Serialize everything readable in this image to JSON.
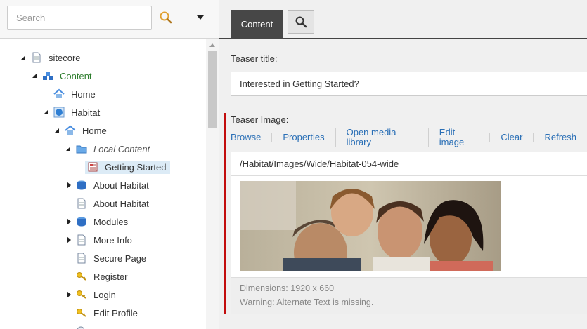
{
  "search": {
    "placeholder": "Search"
  },
  "tree": [
    {
      "label": "sitecore",
      "toggle": "expanded",
      "icon": "page-icon"
    },
    {
      "label": "Content",
      "toggle": "expanded",
      "icon": "content-cubes-icon"
    },
    {
      "label": "Home",
      "toggle": "none",
      "icon": "home-icon"
    },
    {
      "label": "Habitat",
      "toggle": "expanded",
      "icon": "globe-icon"
    },
    {
      "label": "Home",
      "toggle": "expanded",
      "icon": "home-icon"
    },
    {
      "label": "Local Content",
      "toggle": "expanded",
      "icon": "folder-icon"
    },
    {
      "label": "Getting Started",
      "toggle": "none",
      "icon": "teaser-icon",
      "selected": true
    },
    {
      "label": "About Habitat",
      "toggle": "collapsed",
      "icon": "database-icon"
    },
    {
      "label": "About Habitat",
      "toggle": "none",
      "icon": "page-icon"
    },
    {
      "label": "Modules",
      "toggle": "collapsed",
      "icon": "database-icon"
    },
    {
      "label": "More Info",
      "toggle": "collapsed",
      "icon": "page-icon"
    },
    {
      "label": "Secure Page",
      "toggle": "none",
      "icon": "page-icon"
    },
    {
      "label": "Register",
      "toggle": "none",
      "icon": "key-icon"
    },
    {
      "label": "Login",
      "toggle": "collapsed",
      "icon": "key-icon"
    },
    {
      "label": "Edit Profile",
      "toggle": "none",
      "icon": "key-icon"
    }
  ],
  "tabs": {
    "content_label": "Content"
  },
  "teaser_title": {
    "label": "Teaser title:",
    "value": "Interested in Getting Started?"
  },
  "teaser_image": {
    "label": "Teaser Image:",
    "actions": [
      "Browse",
      "Properties",
      "Open media library",
      "Edit image",
      "Clear",
      "Refresh"
    ],
    "path": "/Habitat/Images/Wide/Habitat-054-wide",
    "dimensions": "Dimensions: 1920 x 660",
    "warning": "Warning: Alternate Text is missing."
  },
  "colors": {
    "accent_required": "#c20d0d",
    "link": "#2a6fb6",
    "tab_active": "#474747",
    "tree_green": "#2d7d2d"
  }
}
